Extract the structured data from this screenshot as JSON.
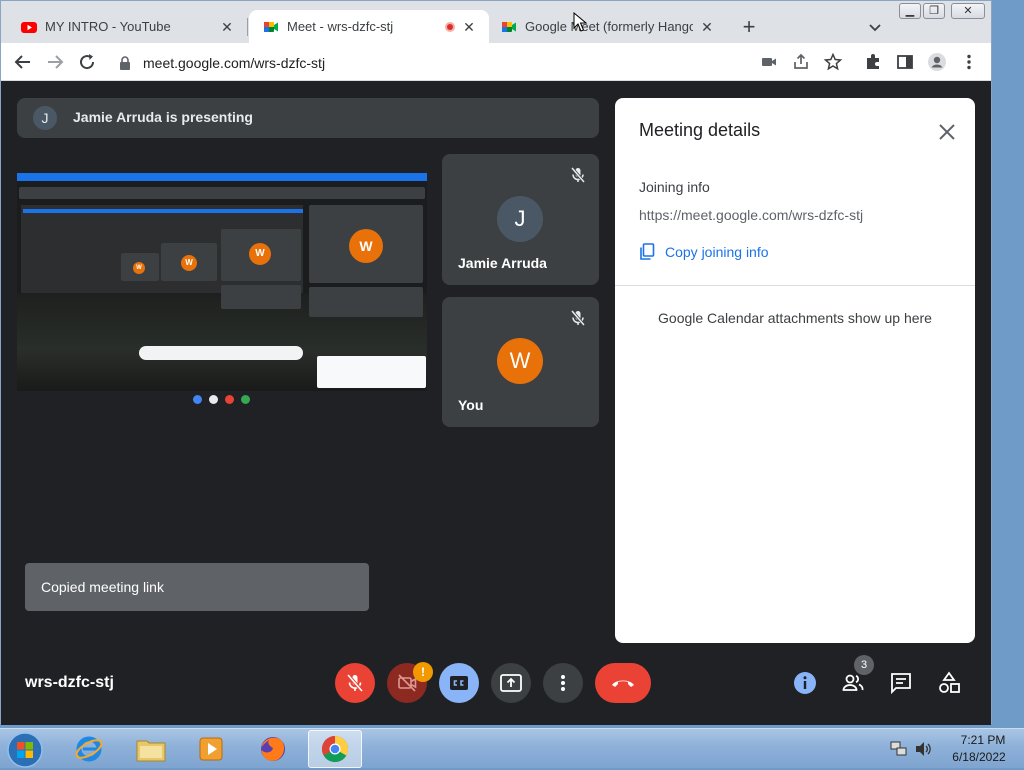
{
  "browser": {
    "tabs": [
      {
        "title": "MY INTRO - YouTube",
        "icon": "youtube-icon",
        "active": false
      },
      {
        "title": "Meet - wrs-dzfc-stj",
        "icon": "meet-icon",
        "active": true,
        "recording": true
      },
      {
        "title": "Google Meet (formerly Hangouts",
        "icon": "meet-icon",
        "active": false
      }
    ],
    "new_tab": "+",
    "url": "meet.google.com/wrs-dzfc-stj"
  },
  "meet": {
    "presenter_initial": "J",
    "presenting_text": "Jamie Arruda is presenting",
    "participants": [
      {
        "initial": "J",
        "name": "Jamie Arruda",
        "avatar_color": "#4a5866",
        "muted": true
      },
      {
        "initial": "W",
        "name": "You",
        "avatar_color": "#e8710a",
        "muted": true
      }
    ],
    "snackbar": "Copied meeting link",
    "meeting_code": "wrs-dzfc-stj",
    "people_count": "3",
    "camera_warning": "!",
    "details": {
      "title": "Meeting details",
      "joining_heading": "Joining info",
      "joining_url": "https://meet.google.com/wrs-dzfc-stj",
      "copy_label": "Copy joining info",
      "calendar_text": "Google Calendar attachments show up here"
    },
    "shared_screen_avatar": "W"
  },
  "taskbar": {
    "time": "7:21 PM",
    "date": "6/18/2022",
    "apps": [
      "internet-explorer-icon",
      "file-explorer-icon",
      "media-player-icon",
      "firefox-icon",
      "chrome-icon"
    ]
  },
  "colors": {
    "accent": "#1a73e8",
    "end_call": "#ea4335",
    "meet_bg": "#202124",
    "tile_bg": "#3c4043"
  }
}
